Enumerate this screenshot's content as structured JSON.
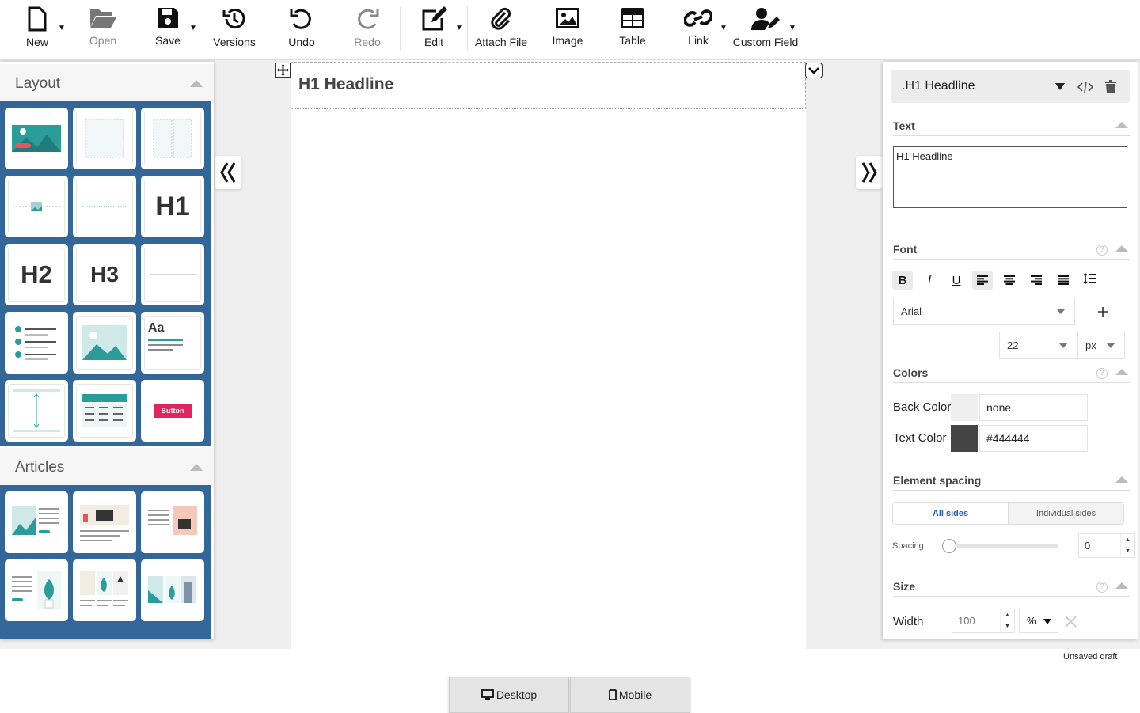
{
  "toolbar": {
    "new": "New",
    "open": "Open",
    "save": "Save",
    "versions": "Versions",
    "undo": "Undo",
    "redo": "Redo",
    "edit": "Edit",
    "attach": "Attach File",
    "image": "Image",
    "table": "Table",
    "link": "Link",
    "custom_field": "Custom Field"
  },
  "left_panel": {
    "layout_title": "Layout",
    "articles_title": "Articles",
    "tiles": {
      "h1": "H1",
      "h2": "H2",
      "h3": "H3",
      "aa": "Aa",
      "button": "Button"
    }
  },
  "canvas": {
    "headline": "H1 Headline"
  },
  "right_panel": {
    "selected": ".H1 Headline",
    "text_section": "Text",
    "text_value": "H1 Headline",
    "font_section": "Font",
    "font_family": "Arial",
    "font_size": "22",
    "font_unit": "px",
    "colors_section": "Colors",
    "back_color_label": "Back Color",
    "back_color_value": "none",
    "text_color_label": "Text Color",
    "text_color_value": "#444444",
    "spacing_section": "Element spacing",
    "all_sides": "All sides",
    "individual_sides": "Individual sides",
    "spacing_label": "Spacing",
    "spacing_value": "0",
    "size_section": "Size",
    "width_label": "Width",
    "width_value": "100",
    "width_unit": "%"
  },
  "status": "Unsaved draft",
  "device": {
    "desktop": "Desktop",
    "mobile": "Mobile"
  },
  "colors": {
    "panel_blue": "#336699",
    "teal": "#2a9d9a",
    "coral": "#e8545a",
    "button_red": "#e0245e"
  }
}
